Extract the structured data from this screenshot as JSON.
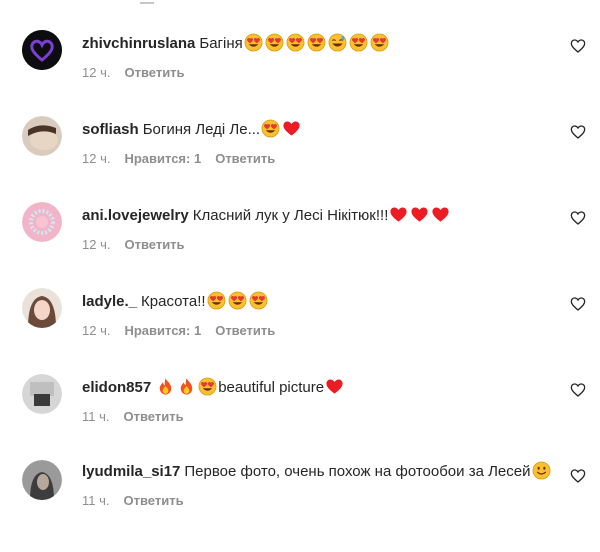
{
  "comments": [
    {
      "username": "zhivchinruslana",
      "text": "Багіня",
      "emojis": [
        "heart-eyes",
        "heart-eyes",
        "heart-eyes",
        "heart-eyes",
        "grinning-sweat",
        "heart-eyes",
        "heart-eyes"
      ],
      "time": "12 ч.",
      "likes": "",
      "reply": "Ответить"
    },
    {
      "username": "sofliash",
      "text": "Богиня Леді Ле...",
      "emojis": [
        "heart-eyes",
        "red-heart"
      ],
      "time": "12 ч.",
      "likes": "Нравится: 1",
      "reply": "Ответить"
    },
    {
      "username": "ani.lovejewelry",
      "text": "Класний лук у Лесі Нікітюк!!!",
      "emojis": [
        "red-heart",
        "red-heart",
        "red-heart"
      ],
      "time": "12 ч.",
      "likes": "",
      "reply": "Ответить"
    },
    {
      "username": "ladyle._",
      "text": "Красота!!",
      "emojis": [
        "heart-eyes",
        "heart-eyes",
        "heart-eyes"
      ],
      "time": "12 ч.",
      "likes": "Нравится: 1",
      "reply": "Ответить"
    },
    {
      "username": "elidon857",
      "text_before": "",
      "emojis_before": [
        "fire",
        "fire",
        "heart-eyes"
      ],
      "text": "beautiful picture",
      "emojis": [
        "red-heart"
      ],
      "time": "11 ч.",
      "likes": "",
      "reply": "Ответить"
    },
    {
      "username": "lyudmila_si17",
      "text": "Первое фото, очень похож на фотообои за Лесей",
      "emojis": [
        "smile"
      ],
      "time": "11 ч.",
      "likes": "",
      "reply": "Ответить"
    }
  ],
  "colors": {
    "text": "#262626",
    "muted": "#8e8e8e",
    "heart": "#ed1c24",
    "emoji": "#fbc02d"
  }
}
